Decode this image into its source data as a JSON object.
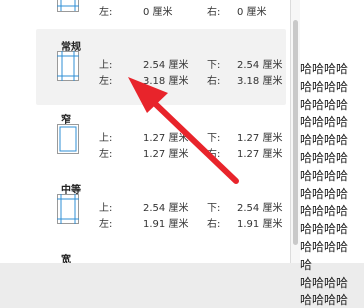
{
  "document": {
    "lines": [
      "哈哈哈哈",
      "哈哈哈哈",
      "哈哈哈哈",
      "哈哈哈哈",
      "哈哈哈哈",
      "哈哈哈哈",
      "哈哈哈哈",
      "哈哈哈哈",
      "哈哈哈哈",
      "哈哈哈哈",
      "哈哈哈哈",
      "哈",
      "哈哈哈哈",
      "哈哈哈哈"
    ]
  },
  "margins_menu": {
    "partial_top": {
      "left_label": "左:",
      "left_value": "0 厘米",
      "right_label": "右:",
      "right_value": "0 厘米"
    },
    "presets": [
      {
        "name": "常规",
        "top_label": "上:",
        "top_value": "2.54 厘米",
        "bottom_label": "下:",
        "bottom_value": "2.54 厘米",
        "left_label": "左:",
        "left_value": "3.18 厘米",
        "right_label": "右:",
        "right_value": "3.18 厘米"
      },
      {
        "name": "窄",
        "top_label": "上:",
        "top_value": "1.27 厘米",
        "bottom_label": "下:",
        "bottom_value": "1.27 厘米",
        "left_label": "左:",
        "left_value": "1.27 厘米",
        "right_label": "右:",
        "right_value": "1.27 厘米"
      },
      {
        "name": "中等",
        "top_label": "上:",
        "top_value": "2.54 厘米",
        "bottom_label": "下:",
        "bottom_value": "2.54 厘米",
        "left_label": "左:",
        "left_value": "1.91 厘米",
        "right_label": "右:",
        "right_value": "1.91 厘米"
      },
      {
        "name": "宽"
      }
    ],
    "hovered_preset": "常规"
  },
  "colors": {
    "annotation_arrow": "#e8242b",
    "margin_icon_stroke": "#2f8fd6"
  }
}
